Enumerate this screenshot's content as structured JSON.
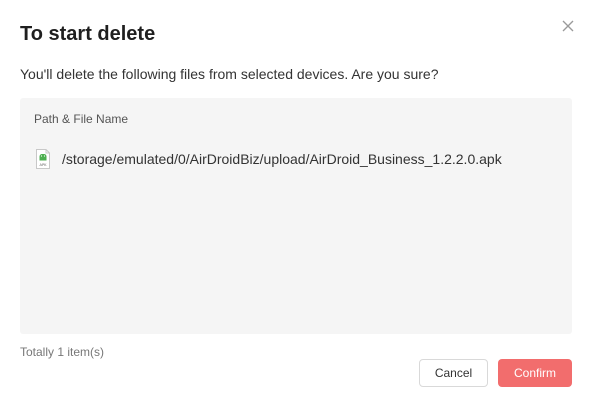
{
  "dialog": {
    "title": "To start delete",
    "message": "You'll delete the following files from selected devices. Are you sure?",
    "close_icon": "close-icon"
  },
  "file_list": {
    "column_header": "Path & File Name",
    "files": [
      {
        "icon": "apk-file-icon",
        "icon_label": "APK",
        "path": "/storage/emulated/0/AirDroidBiz/upload/AirDroid_Business_1.2.2.0.apk"
      }
    ]
  },
  "footer": {
    "total": "Totally 1 item(s)",
    "cancel_label": "Cancel",
    "confirm_label": "Confirm"
  },
  "colors": {
    "confirm_button": "#f26d6d",
    "panel_background": "#f5f5f5",
    "apk_icon_green": "#4caf50"
  }
}
